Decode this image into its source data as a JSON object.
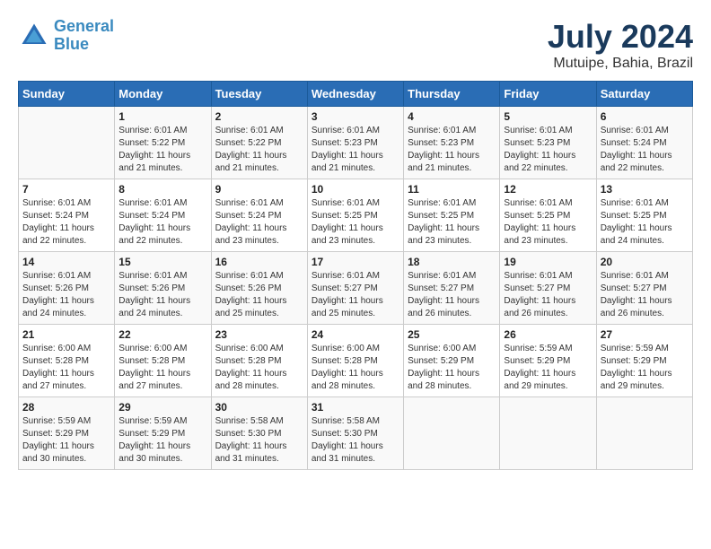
{
  "logo": {
    "line1": "General",
    "line2": "Blue"
  },
  "title": "July 2024",
  "subtitle": "Mutuipe, Bahia, Brazil",
  "days_of_week": [
    "Sunday",
    "Monday",
    "Tuesday",
    "Wednesday",
    "Thursday",
    "Friday",
    "Saturday"
  ],
  "weeks": [
    [
      {
        "day": "",
        "sunrise": "",
        "sunset": "",
        "daylight": ""
      },
      {
        "day": "1",
        "sunrise": "Sunrise: 6:01 AM",
        "sunset": "Sunset: 5:22 PM",
        "daylight": "Daylight: 11 hours and 21 minutes."
      },
      {
        "day": "2",
        "sunrise": "Sunrise: 6:01 AM",
        "sunset": "Sunset: 5:22 PM",
        "daylight": "Daylight: 11 hours and 21 minutes."
      },
      {
        "day": "3",
        "sunrise": "Sunrise: 6:01 AM",
        "sunset": "Sunset: 5:23 PM",
        "daylight": "Daylight: 11 hours and 21 minutes."
      },
      {
        "day": "4",
        "sunrise": "Sunrise: 6:01 AM",
        "sunset": "Sunset: 5:23 PM",
        "daylight": "Daylight: 11 hours and 21 minutes."
      },
      {
        "day": "5",
        "sunrise": "Sunrise: 6:01 AM",
        "sunset": "Sunset: 5:23 PM",
        "daylight": "Daylight: 11 hours and 22 minutes."
      },
      {
        "day": "6",
        "sunrise": "Sunrise: 6:01 AM",
        "sunset": "Sunset: 5:24 PM",
        "daylight": "Daylight: 11 hours and 22 minutes."
      }
    ],
    [
      {
        "day": "7",
        "sunrise": "Sunrise: 6:01 AM",
        "sunset": "Sunset: 5:24 PM",
        "daylight": "Daylight: 11 hours and 22 minutes."
      },
      {
        "day": "8",
        "sunrise": "Sunrise: 6:01 AM",
        "sunset": "Sunset: 5:24 PM",
        "daylight": "Daylight: 11 hours and 22 minutes."
      },
      {
        "day": "9",
        "sunrise": "Sunrise: 6:01 AM",
        "sunset": "Sunset: 5:24 PM",
        "daylight": "Daylight: 11 hours and 23 minutes."
      },
      {
        "day": "10",
        "sunrise": "Sunrise: 6:01 AM",
        "sunset": "Sunset: 5:25 PM",
        "daylight": "Daylight: 11 hours and 23 minutes."
      },
      {
        "day": "11",
        "sunrise": "Sunrise: 6:01 AM",
        "sunset": "Sunset: 5:25 PM",
        "daylight": "Daylight: 11 hours and 23 minutes."
      },
      {
        "day": "12",
        "sunrise": "Sunrise: 6:01 AM",
        "sunset": "Sunset: 5:25 PM",
        "daylight": "Daylight: 11 hours and 23 minutes."
      },
      {
        "day": "13",
        "sunrise": "Sunrise: 6:01 AM",
        "sunset": "Sunset: 5:25 PM",
        "daylight": "Daylight: 11 hours and 24 minutes."
      }
    ],
    [
      {
        "day": "14",
        "sunrise": "Sunrise: 6:01 AM",
        "sunset": "Sunset: 5:26 PM",
        "daylight": "Daylight: 11 hours and 24 minutes."
      },
      {
        "day": "15",
        "sunrise": "Sunrise: 6:01 AM",
        "sunset": "Sunset: 5:26 PM",
        "daylight": "Daylight: 11 hours and 24 minutes."
      },
      {
        "day": "16",
        "sunrise": "Sunrise: 6:01 AM",
        "sunset": "Sunset: 5:26 PM",
        "daylight": "Daylight: 11 hours and 25 minutes."
      },
      {
        "day": "17",
        "sunrise": "Sunrise: 6:01 AM",
        "sunset": "Sunset: 5:27 PM",
        "daylight": "Daylight: 11 hours and 25 minutes."
      },
      {
        "day": "18",
        "sunrise": "Sunrise: 6:01 AM",
        "sunset": "Sunset: 5:27 PM",
        "daylight": "Daylight: 11 hours and 26 minutes."
      },
      {
        "day": "19",
        "sunrise": "Sunrise: 6:01 AM",
        "sunset": "Sunset: 5:27 PM",
        "daylight": "Daylight: 11 hours and 26 minutes."
      },
      {
        "day": "20",
        "sunrise": "Sunrise: 6:01 AM",
        "sunset": "Sunset: 5:27 PM",
        "daylight": "Daylight: 11 hours and 26 minutes."
      }
    ],
    [
      {
        "day": "21",
        "sunrise": "Sunrise: 6:00 AM",
        "sunset": "Sunset: 5:28 PM",
        "daylight": "Daylight: 11 hours and 27 minutes."
      },
      {
        "day": "22",
        "sunrise": "Sunrise: 6:00 AM",
        "sunset": "Sunset: 5:28 PM",
        "daylight": "Daylight: 11 hours and 27 minutes."
      },
      {
        "day": "23",
        "sunrise": "Sunrise: 6:00 AM",
        "sunset": "Sunset: 5:28 PM",
        "daylight": "Daylight: 11 hours and 28 minutes."
      },
      {
        "day": "24",
        "sunrise": "Sunrise: 6:00 AM",
        "sunset": "Sunset: 5:28 PM",
        "daylight": "Daylight: 11 hours and 28 minutes."
      },
      {
        "day": "25",
        "sunrise": "Sunrise: 6:00 AM",
        "sunset": "Sunset: 5:29 PM",
        "daylight": "Daylight: 11 hours and 28 minutes."
      },
      {
        "day": "26",
        "sunrise": "Sunrise: 5:59 AM",
        "sunset": "Sunset: 5:29 PM",
        "daylight": "Daylight: 11 hours and 29 minutes."
      },
      {
        "day": "27",
        "sunrise": "Sunrise: 5:59 AM",
        "sunset": "Sunset: 5:29 PM",
        "daylight": "Daylight: 11 hours and 29 minutes."
      }
    ],
    [
      {
        "day": "28",
        "sunrise": "Sunrise: 5:59 AM",
        "sunset": "Sunset: 5:29 PM",
        "daylight": "Daylight: 11 hours and 30 minutes."
      },
      {
        "day": "29",
        "sunrise": "Sunrise: 5:59 AM",
        "sunset": "Sunset: 5:29 PM",
        "daylight": "Daylight: 11 hours and 30 minutes."
      },
      {
        "day": "30",
        "sunrise": "Sunrise: 5:58 AM",
        "sunset": "Sunset: 5:30 PM",
        "daylight": "Daylight: 11 hours and 31 minutes."
      },
      {
        "day": "31",
        "sunrise": "Sunrise: 5:58 AM",
        "sunset": "Sunset: 5:30 PM",
        "daylight": "Daylight: 11 hours and 31 minutes."
      },
      {
        "day": "",
        "sunrise": "",
        "sunset": "",
        "daylight": ""
      },
      {
        "day": "",
        "sunrise": "",
        "sunset": "",
        "daylight": ""
      },
      {
        "day": "",
        "sunrise": "",
        "sunset": "",
        "daylight": ""
      }
    ]
  ]
}
